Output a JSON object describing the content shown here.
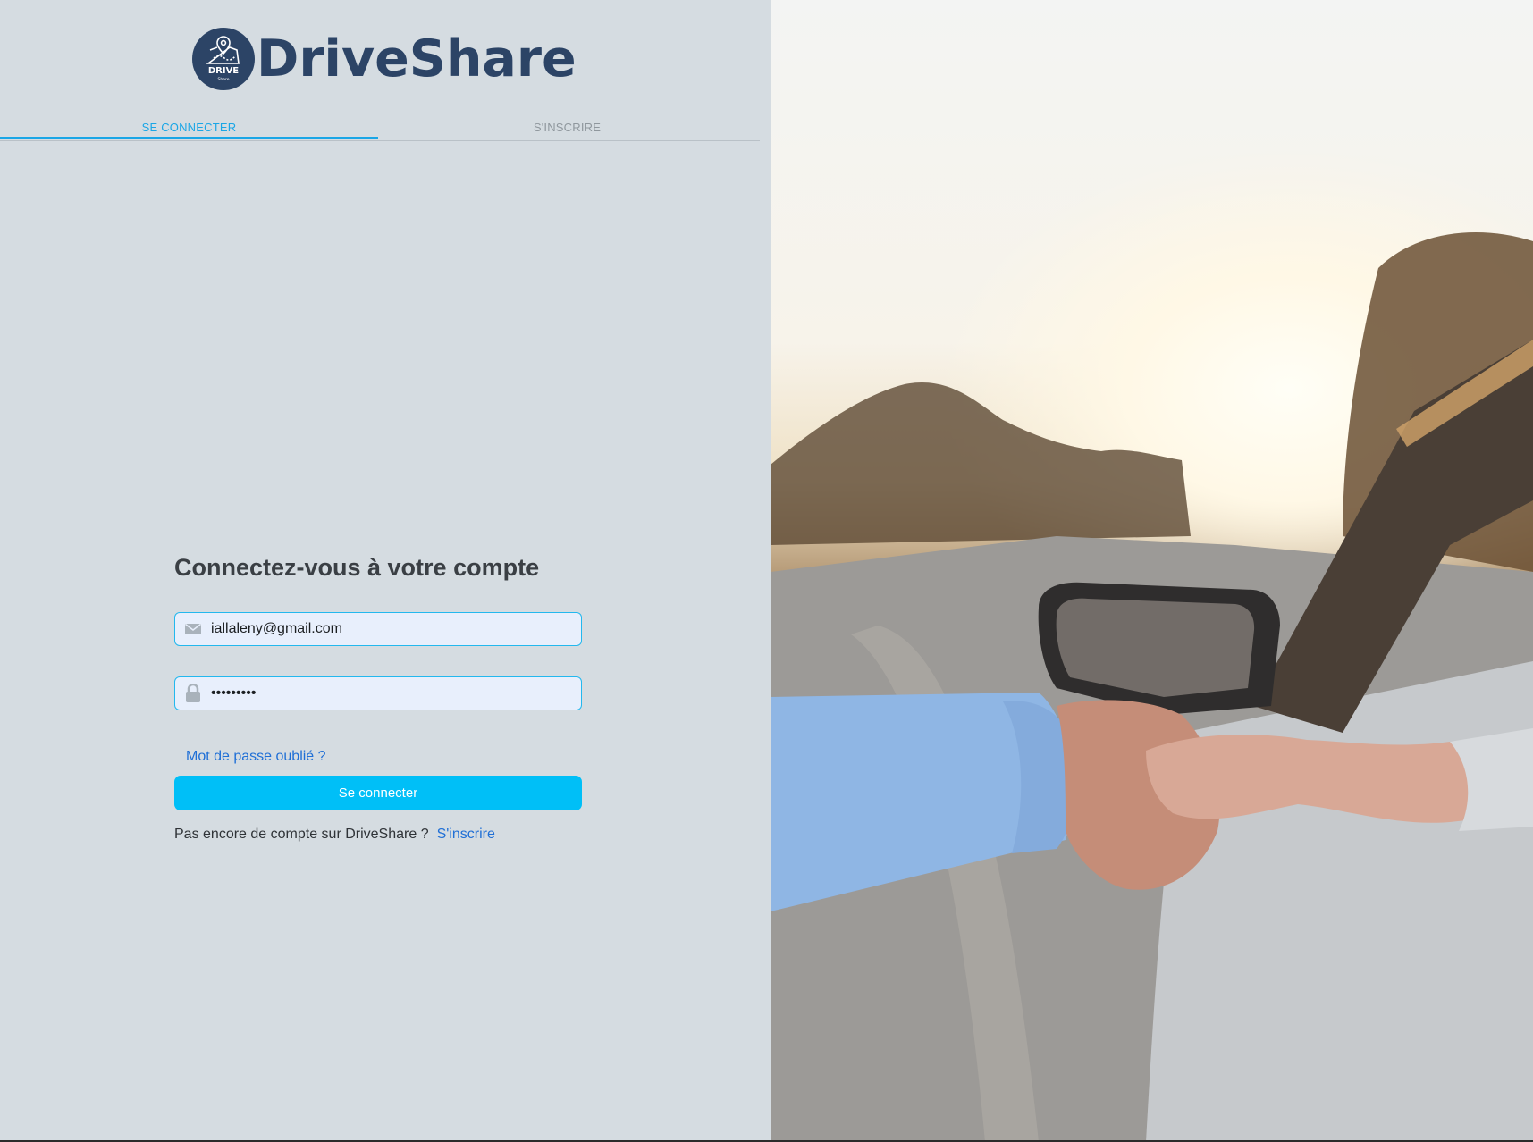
{
  "brand": {
    "name": "DriveShare",
    "badge_text": "DRIVE",
    "badge_subtext": "Share"
  },
  "tabs": [
    {
      "label": "SE CONNECTER",
      "active": true
    },
    {
      "label": "S'INSCRIRE",
      "active": false
    }
  ],
  "login": {
    "heading": "Connectez-vous à votre compte",
    "email_value": "iallaleny@gmail.com",
    "email_icon": "envelope-icon",
    "password_value": "•••••••••",
    "password_icon": "lock-icon",
    "forgot_link": "Mot de passe oublié ?",
    "submit_label": "Se connecter",
    "signup_prompt": "Pas encore de compte sur DriveShare ?",
    "signup_link": "S'inscrire"
  },
  "colors": {
    "accent": "#1aa6e6",
    "button": "#00bff7",
    "link": "#1f6fd6",
    "brand": "#2c4466",
    "panel_bg": "#d5dce1"
  }
}
